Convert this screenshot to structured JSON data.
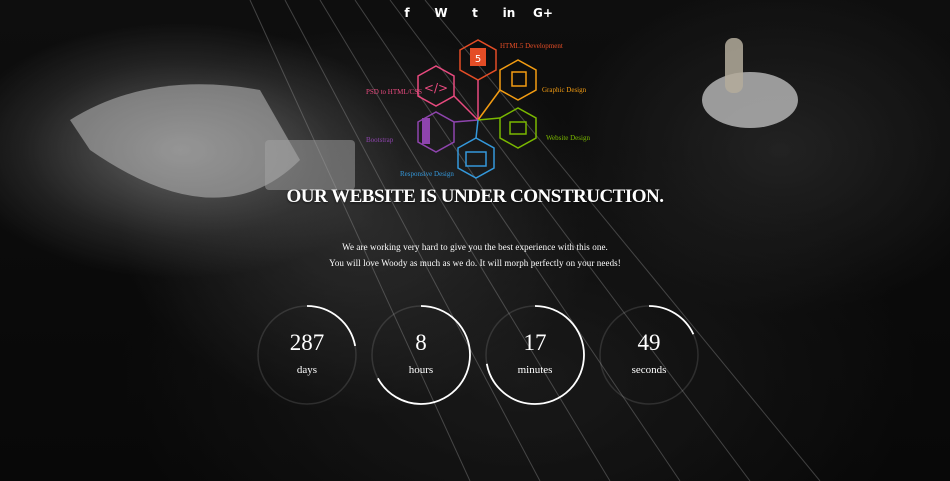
{
  "social": [
    {
      "name": "facebook-icon",
      "glyph": "f"
    },
    {
      "name": "wordpress-icon",
      "glyph": "W"
    },
    {
      "name": "twitter-icon",
      "glyph": "t"
    },
    {
      "name": "linkedin-icon",
      "glyph": "in"
    },
    {
      "name": "google-plus-icon",
      "glyph": "G+"
    }
  ],
  "services": {
    "html5": "HTML5 Development",
    "graphic": "Graphic Design",
    "psd": "PSD to HTML/CSS",
    "website": "Website Design",
    "bootstrap": "Bootstrap",
    "responsive": "Responsive Design"
  },
  "headline": "OUR WEBSITE IS UNDER CONSTRUCTION.",
  "sub_line1": "We are working very hard to give you the best experience with this one.",
  "sub_line2": "You will love Woody as much as we do. It will morph perfectly on your needs!",
  "countdown": [
    {
      "value": "287",
      "label": "days",
      "progress": 0.22
    },
    {
      "value": "8",
      "label": "hours",
      "progress": 0.67
    },
    {
      "value": "17",
      "label": "minutes",
      "progress": 0.72
    },
    {
      "value": "49",
      "label": "seconds",
      "progress": 0.18
    }
  ],
  "colors": {
    "html5": "#e44d26",
    "graphic": "#f39c12",
    "psd": "#e84a7f",
    "website": "#7ab800",
    "bootstrap": "#8e44ad",
    "responsive": "#3498db"
  }
}
